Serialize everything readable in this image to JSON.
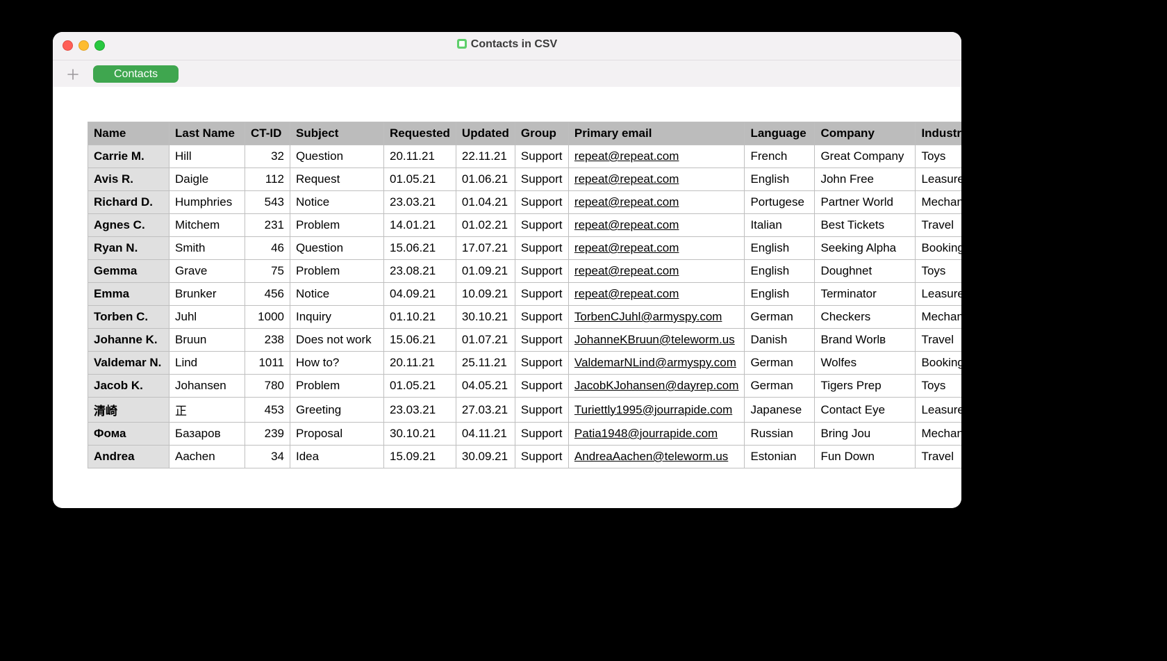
{
  "window": {
    "title": "Contacts in CSV"
  },
  "tabs": {
    "add_tooltip": "Add Sheet",
    "active": "Contacts"
  },
  "table": {
    "headers": [
      "Name",
      "Last Name",
      "CT-ID",
      "Subject",
      "Requested",
      "Updated",
      "Group",
      "Primary email",
      "Language",
      "Company",
      "Industry"
    ],
    "rows": [
      {
        "name": "Carrie M.",
        "last": "Hill",
        "ct": "32",
        "subject": "Question",
        "requested": "20.11.21",
        "updated": "22.11.21",
        "group": "Support",
        "email": "repeat@repeat.com",
        "language": "French",
        "company": "Great Company",
        "industry": "Toys"
      },
      {
        "name": "Avis R.",
        "last": "Daigle",
        "ct": "112",
        "subject": "Request",
        "requested": "01.05.21",
        "updated": "01.06.21",
        "group": "Support",
        "email": "repeat@repeat.com",
        "language": "English",
        "company": "John Free",
        "industry": "Leasure"
      },
      {
        "name": "Richard D.",
        "last": "Humphries",
        "ct": "543",
        "subject": "Notice",
        "requested": "23.03.21",
        "updated": "01.04.21",
        "group": "Support",
        "email": "repeat@repeat.com",
        "language": "Portugese",
        "company": "Partner World",
        "industry": "Mechanics"
      },
      {
        "name": "Agnes C.",
        "last": "Mitchem",
        "ct": "231",
        "subject": "Problem",
        "requested": "14.01.21",
        "updated": "01.02.21",
        "group": "Support",
        "email": "repeat@repeat.com",
        "language": "Italian",
        "company": "Best Tickets",
        "industry": "Travel"
      },
      {
        "name": "Ryan N.",
        "last": "Smith",
        "ct": "46",
        "subject": "Question",
        "requested": "15.06.21",
        "updated": "17.07.21",
        "group": "Support",
        "email": "repeat@repeat.com",
        "language": "English",
        "company": "Seeking Alpha",
        "industry": "Booking"
      },
      {
        "name": "Gemma",
        "last": "Grave",
        "ct": "75",
        "subject": "Problem",
        "requested": "23.08.21",
        "updated": "01.09.21",
        "group": "Support",
        "email": "repeat@repeat.com",
        "language": "English",
        "company": "Doughnet",
        "industry": "Toys"
      },
      {
        "name": "Emma",
        "last": "Brunker",
        "ct": "456",
        "subject": "Notice",
        "requested": "04.09.21",
        "updated": "10.09.21",
        "group": "Support",
        "email": "repeat@repeat.com",
        "language": "English",
        "company": "Terminator",
        "industry": "Leasure"
      },
      {
        "name": "Torben C.",
        "last": "Juhl",
        "ct": "1000",
        "subject": "Inquiry",
        "requested": "01.10.21",
        "updated": "30.10.21",
        "group": "Support",
        "email": "TorbenCJuhl@armyspy.com",
        "language": "German",
        "company": "Checkers",
        "industry": "Mechanics"
      },
      {
        "name": "Johanne K.",
        "last": "Bruun",
        "ct": "238",
        "subject": "Does not work",
        "requested": "15.06.21",
        "updated": "01.07.21",
        "group": "Support",
        "email": "JohanneKBruun@teleworm.us",
        "language": "Danish",
        "company": "Brand Worlв",
        "industry": "Travel"
      },
      {
        "name": "Valdemar N.",
        "last": "Lind",
        "ct": "1011",
        "subject": "How to?",
        "requested": "20.11.21",
        "updated": "25.11.21",
        "group": "Support",
        "email": "ValdemarNLind@armyspy.com",
        "language": "German",
        "company": "Wolfes",
        "industry": "Booking"
      },
      {
        "name": "Jacob K.",
        "last": "Johansen",
        "ct": "780",
        "subject": "Problem",
        "requested": "01.05.21",
        "updated": "04.05.21",
        "group": "Support",
        "email": "JacobKJohansen@dayrep.com",
        "language": "German",
        "company": "Tigers Prep",
        "industry": "Toys"
      },
      {
        "name": "清崎",
        "last": "正",
        "ct": "453",
        "subject": "Greeting",
        "requested": "23.03.21",
        "updated": "27.03.21",
        "group": "Support",
        "email": "Turiettly1995@jourrapide.com",
        "language": "Japanese",
        "company": "Contact Eye",
        "industry": "Leasure"
      },
      {
        "name": "Фома",
        "last": "Базаров",
        "ct": "239",
        "subject": "Proposal",
        "requested": "30.10.21",
        "updated": "04.11.21",
        "group": "Support",
        "email": "Patia1948@jourrapide.com",
        "language": "Russian",
        "company": "Bring Jou",
        "industry": "Mechanics"
      },
      {
        "name": "Andrea",
        "last": "Aachen",
        "ct": "34",
        "subject": "Idea",
        "requested": "15.09.21",
        "updated": "30.09.21",
        "group": "Support",
        "email": "AndreaAachen@teleworm.us",
        "language": "Estonian",
        "company": "Fun Down",
        "industry": "Travel"
      }
    ]
  }
}
